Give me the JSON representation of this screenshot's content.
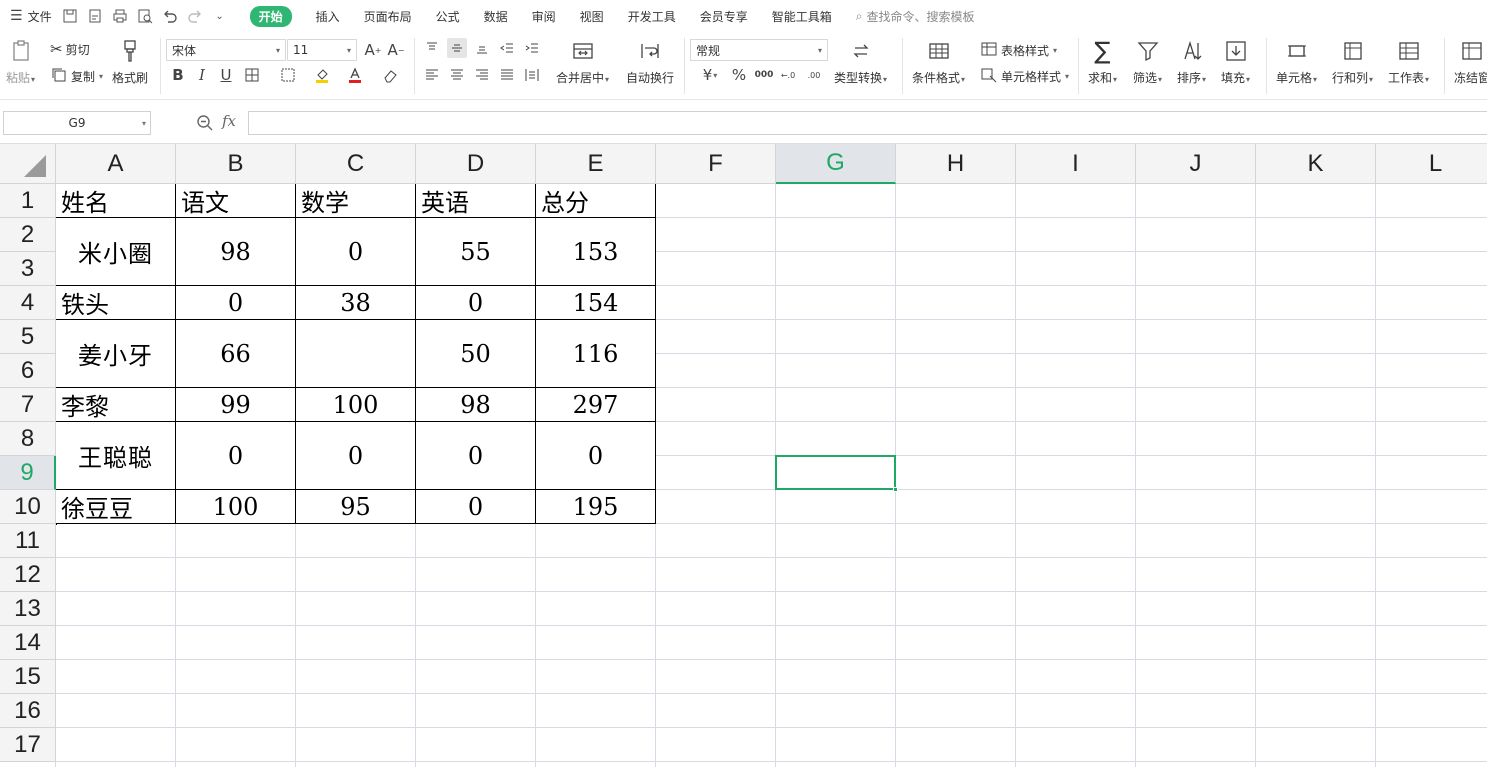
{
  "menubar": {
    "file_label": "文件",
    "tabs": [
      "开始",
      "插入",
      "页面布局",
      "公式",
      "数据",
      "审阅",
      "视图",
      "开发工具",
      "会员专享",
      "智能工具箱"
    ],
    "search_label": "查找命令、搜索模板"
  },
  "ribbon": {
    "paste": "粘贴",
    "cut": "剪切",
    "copy": "复制",
    "format_painter": "格式刷",
    "font_name": "宋体",
    "font_size": "11",
    "merge_center": "合并居中",
    "wrap_text": "自动换行",
    "number_format": "常规",
    "type_convert": "类型转换",
    "conditional_format": "条件格式",
    "table_style": "表格样式",
    "cell_style": "单元格样式",
    "sum": "求和",
    "filter": "筛选",
    "sort": "排序",
    "fill": "填充",
    "cell": "单元格",
    "row_col": "行和列",
    "worksheet": "工作表",
    "freeze": "冻结窗"
  },
  "formula_bar": {
    "name_box": "G9",
    "fx_label": "fx",
    "formula": ""
  },
  "grid": {
    "columns": [
      "A",
      "B",
      "C",
      "D",
      "E",
      "F",
      "G",
      "H",
      "I",
      "J",
      "K",
      "L"
    ],
    "rows": [
      "1",
      "2",
      "3",
      "4",
      "5",
      "6",
      "7",
      "8",
      "9",
      "10",
      "11",
      "12",
      "13",
      "14",
      "15",
      "16",
      "17"
    ],
    "selected_cell": "G9"
  },
  "table": {
    "headers": [
      "姓名",
      "语文",
      "数学",
      "英语",
      "总分"
    ],
    "records": [
      {
        "name": "米小圈",
        "chinese": "98",
        "math": "0",
        "english": "55",
        "total": "153"
      },
      {
        "name": "铁头",
        "chinese": "0",
        "math": "38",
        "english": "0",
        "total": "154"
      },
      {
        "name": "姜小牙",
        "chinese": "66",
        "math": "",
        "english": "50",
        "total": "116"
      },
      {
        "name": "李黎",
        "chinese": "99",
        "math": "100",
        "english": "98",
        "total": "297"
      },
      {
        "name": "王聪聪",
        "chinese": "0",
        "math": "0",
        "english": "0",
        "total": "0"
      },
      {
        "name": "徐豆豆",
        "chinese": "100",
        "math": "95",
        "english": "0",
        "total": "195"
      }
    ]
  },
  "colors": {
    "accent": "#20a865",
    "tab_active": "#2fb673"
  }
}
